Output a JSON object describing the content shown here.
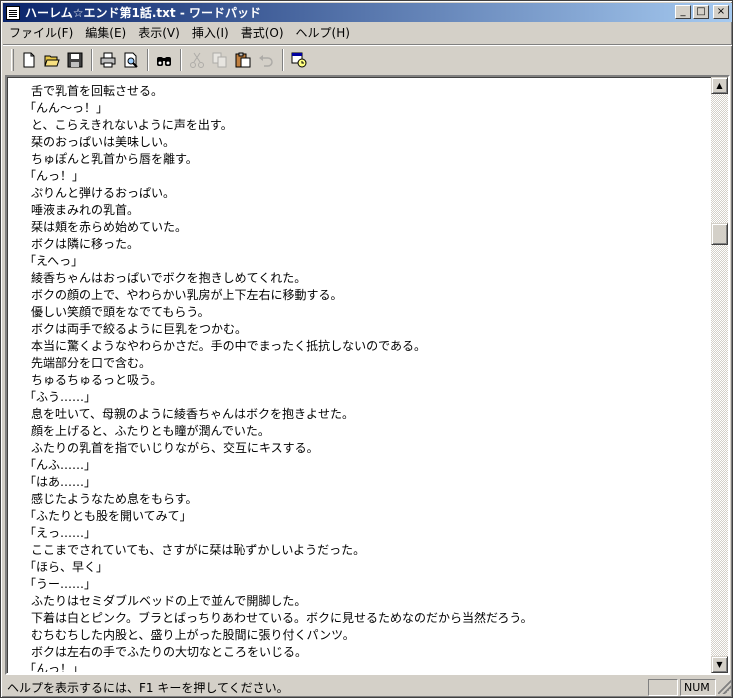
{
  "window": {
    "title": "ハーレム☆エンド第1話.txt - ワードパッド"
  },
  "title_buttons": {
    "minimize": "_",
    "maximize": "□",
    "close": "×"
  },
  "menu": [
    {
      "label": "ファイル(F)"
    },
    {
      "label": "編集(E)"
    },
    {
      "label": "表示(V)"
    },
    {
      "label": "挿入(I)"
    },
    {
      "label": "書式(O)"
    },
    {
      "label": "ヘルプ(H)"
    }
  ],
  "toolbar": {
    "icons": [
      "new-icon",
      "open-icon",
      "save-icon",
      "print-icon",
      "print-preview-icon",
      "find-icon",
      "cut-icon",
      "copy-icon",
      "paste-icon",
      "undo-icon",
      "date-time-icon"
    ]
  },
  "document": {
    "lines": [
      "舌で乳首を回転させる。",
      "「んん〜っ！」",
      "と、こらえきれないように声を出す。",
      "栞のおっぱいは美味しい。",
      "ちゅぽんと乳首から唇を離す。",
      "「んっ！」",
      "ぷりんと弾けるおっぱい。",
      "唾液まみれの乳首。",
      "栞は頬を赤らめ始めていた。",
      "ボクは隣に移った。",
      "「えへっ」",
      "綾香ちゃんはおっぱいでボクを抱きしめてくれた。",
      "ボクの顔の上で、やわらかい乳房が上下左右に移動する。",
      "優しい笑顔で頭をなでてもらう。",
      "ボクは両手で絞るように巨乳をつかむ。",
      "本当に驚くようなやわらかさだ。手の中でまったく抵抗しないのである。",
      "先端部分を口で含む。",
      "ちゅるちゅるっと吸う。",
      "「ふう……」",
      "息を吐いて、母親のように綾香ちゃんはボクを抱きよせた。",
      "顔を上げると、ふたりとも瞳が潤んでいた。",
      "ふたりの乳首を指でいじりながら、交互にキスする。",
      "「んふ……」",
      "「はあ……」",
      "感じたようなため息をもらす。",
      "「ふたりとも股を開いてみて」",
      "「えっ……」",
      "ここまでされていても、さすがに栞は恥ずかしいようだった。",
      "「ほら、早く」",
      "「うー……」",
      "ふたりはセミダブルベッドの上で並んで開脚した。",
      "下着は白とピンク。ブラとばっちりあわせている。ボクに見せるためなのだから当然だろう。",
      "むちむちした内股と、盛り上がった股間に張り付くパンツ。",
      "ボクは左右の手でふたりの大切なところをいじる。",
      "「んっ！」"
    ]
  },
  "statusbar": {
    "help_text": "ヘルプを表示するには、F1 キーを押してください。",
    "num": "NUM"
  }
}
